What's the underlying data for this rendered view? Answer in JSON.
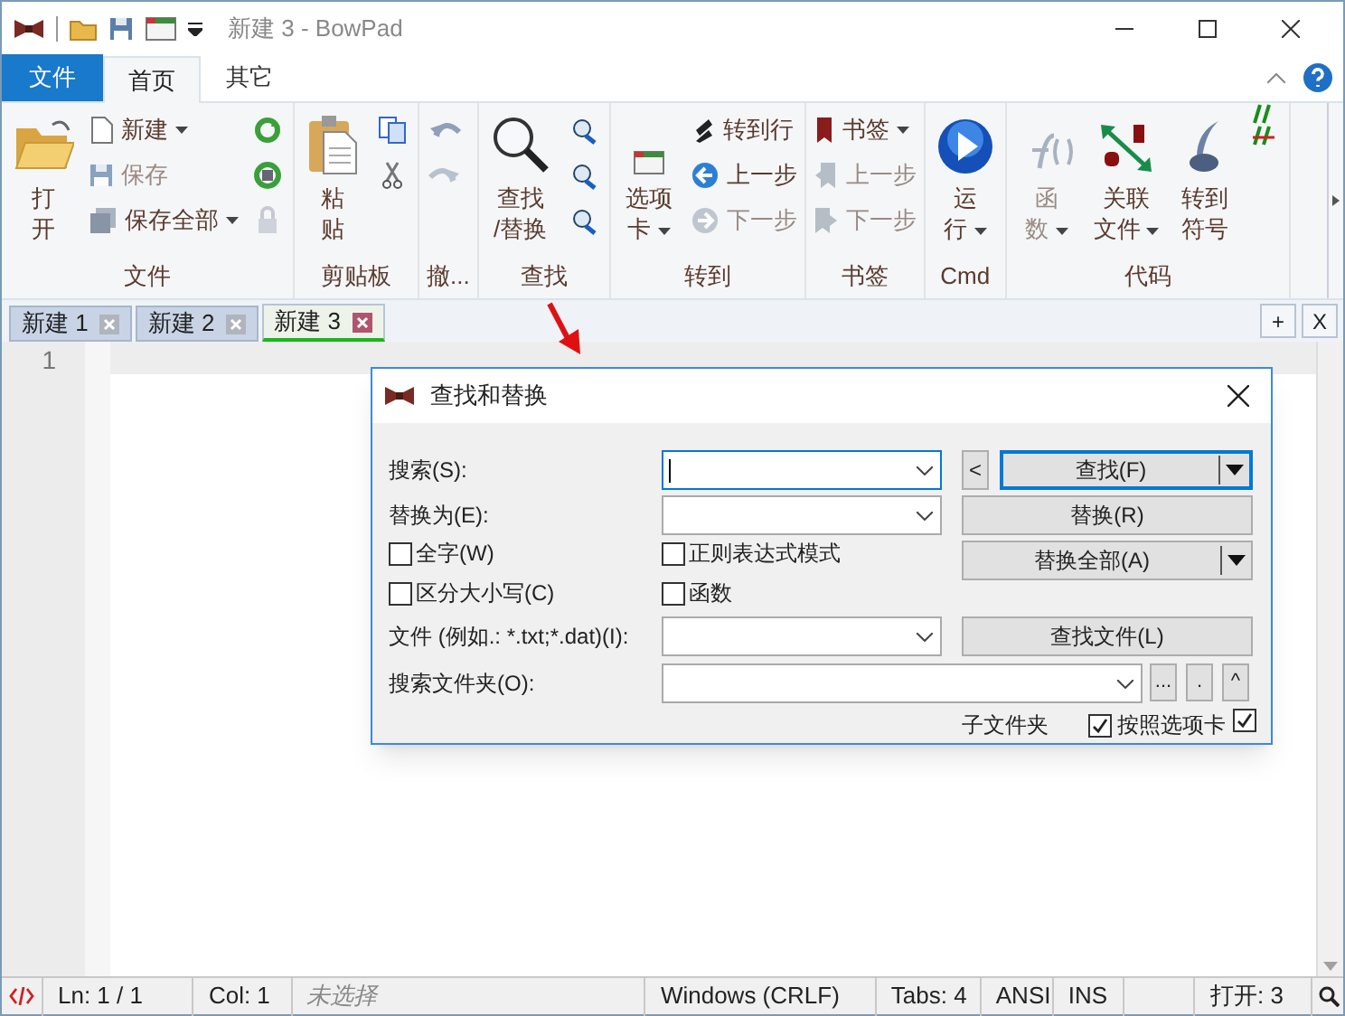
{
  "window": {
    "title": "新建 3 - BowPad"
  },
  "ribbon_tabs": [
    {
      "label": "文件",
      "kind": "menu",
      "selected": false
    },
    {
      "label": "首页",
      "kind": "tab",
      "selected": true
    },
    {
      "label": "其它",
      "kind": "tab",
      "selected": false
    }
  ],
  "ribbon_groups": [
    {
      "label": "文件",
      "columns": [
        [
          {
            "kind": "large",
            "lines": [
              "打",
              "开"
            ],
            "disabled": false
          }
        ],
        [
          {
            "kind": "small",
            "label": "新建",
            "dropdown": true,
            "disabled": false
          },
          {
            "kind": "small",
            "label": "保存",
            "dropdown": false,
            "disabled": true
          },
          {
            "kind": "small",
            "label": "保存全部",
            "dropdown": true,
            "disabled": false
          }
        ],
        [
          {
            "kind": "icon",
            "disabled": false
          },
          {
            "kind": "icon",
            "disabled": false
          },
          {
            "kind": "icon",
            "disabled": true
          }
        ]
      ]
    },
    {
      "label": "剪贴板",
      "columns": [
        [
          {
            "kind": "large",
            "lines": [
              "粘",
              "贴"
            ],
            "disabled": false
          }
        ],
        [
          {
            "kind": "icon",
            "disabled": false
          },
          {
            "kind": "icon",
            "disabled": false
          }
        ]
      ]
    },
    {
      "label": "撤...",
      "columns": [
        [
          {
            "kind": "icon",
            "disabled": false
          },
          {
            "kind": "icon",
            "disabled": true
          }
        ]
      ]
    },
    {
      "label": "查找",
      "columns": [
        [
          {
            "kind": "large",
            "lines": [
              "查找",
              "/替换"
            ],
            "disabled": false
          }
        ],
        [
          {
            "kind": "icon",
            "disabled": false
          },
          {
            "kind": "icon",
            "disabled": false
          },
          {
            "kind": "icon",
            "disabled": false
          }
        ]
      ]
    },
    {
      "label": "转到",
      "columns": [
        [
          {
            "kind": "large",
            "lines": [
              "选项",
              "卡"
            ],
            "dropdown": true,
            "disabled": false
          }
        ],
        [
          {
            "kind": "small",
            "label": "转到行",
            "dropdown": false,
            "disabled": false
          },
          {
            "kind": "small",
            "label": "上一步",
            "dropdown": false,
            "disabled": false
          },
          {
            "kind": "small",
            "label": "下一步",
            "dropdown": false,
            "disabled": true
          }
        ]
      ]
    },
    {
      "label": "书签",
      "columns": [
        [
          {
            "kind": "small",
            "label": "书签",
            "dropdown": true,
            "disabled": false
          },
          {
            "kind": "small",
            "label": "上一步",
            "dropdown": false,
            "disabled": true
          },
          {
            "kind": "small",
            "label": "下一步",
            "dropdown": false,
            "disabled": true
          }
        ]
      ]
    },
    {
      "label": "Cmd",
      "columns": [
        [
          {
            "kind": "large",
            "lines": [
              "运",
              "行"
            ],
            "dropdown": true,
            "disabled": false
          }
        ]
      ]
    },
    {
      "label": "代码",
      "columns": [
        [
          {
            "kind": "large",
            "lines": [
              "函",
              "数"
            ],
            "dropdown": true,
            "disabled": true
          }
        ],
        [
          {
            "kind": "large",
            "lines": [
              "关联",
              "文件"
            ],
            "dropdown": true,
            "disabled": false
          }
        ],
        [
          {
            "kind": "large",
            "lines": [
              "转到",
              "符号"
            ],
            "disabled": false
          }
        ],
        [
          {
            "kind": "icon",
            "disabled": false
          }
        ]
      ]
    }
  ],
  "doc_tabs": [
    {
      "label": "新建 1",
      "selected": false
    },
    {
      "label": "新建 2",
      "selected": false
    },
    {
      "label": "新建 3",
      "selected": true
    }
  ],
  "tab_buttons": [
    "+",
    "X"
  ],
  "editor": {
    "line_numbers": [
      "1"
    ]
  },
  "dialog": {
    "title": "查找和替换",
    "rows": [
      {
        "label": "搜索(S):",
        "field": {
          "focused": true
        }
      },
      {
        "label": "替换为(E):",
        "field": {
          "focused": false
        }
      },
      {
        "label": "文件 (例如.: *.txt;*.dat)(I):",
        "field": {
          "focused": false
        }
      },
      {
        "label": "搜索文件夹(O):",
        "field": {
          "focused": false
        }
      }
    ],
    "checkboxes": [
      {
        "label": "全字(W)",
        "checked": false
      },
      {
        "label": "正则表达式模式",
        "checked": false
      },
      {
        "label": "区分大小写(C)",
        "checked": false
      },
      {
        "label": "函数",
        "checked": false
      }
    ],
    "buttons": [
      {
        "label": "<",
        "kind": "small",
        "focused": false
      },
      {
        "label": "查找(F)",
        "kind": "split",
        "focused": true
      },
      {
        "label": "替换(R)",
        "kind": "plain",
        "focused": false
      },
      {
        "label": "替换全部(A)",
        "kind": "split",
        "focused": false
      },
      {
        "label": "查找文件(L)",
        "kind": "plain",
        "focused": false
      }
    ],
    "folder_buttons": [
      "...",
      ".",
      "^"
    ],
    "options_label": "子文件夹",
    "options": [
      {
        "label": "按照选项卡",
        "checked": true
      },
      {
        "checked": true
      }
    ]
  },
  "status_bar": [
    "Ln: 1 / 1",
    "Col: 1",
    "未选择",
    "Windows (CRLF)",
    "Tabs: 4",
    "ANSI",
    "INS",
    "打开: 3"
  ]
}
